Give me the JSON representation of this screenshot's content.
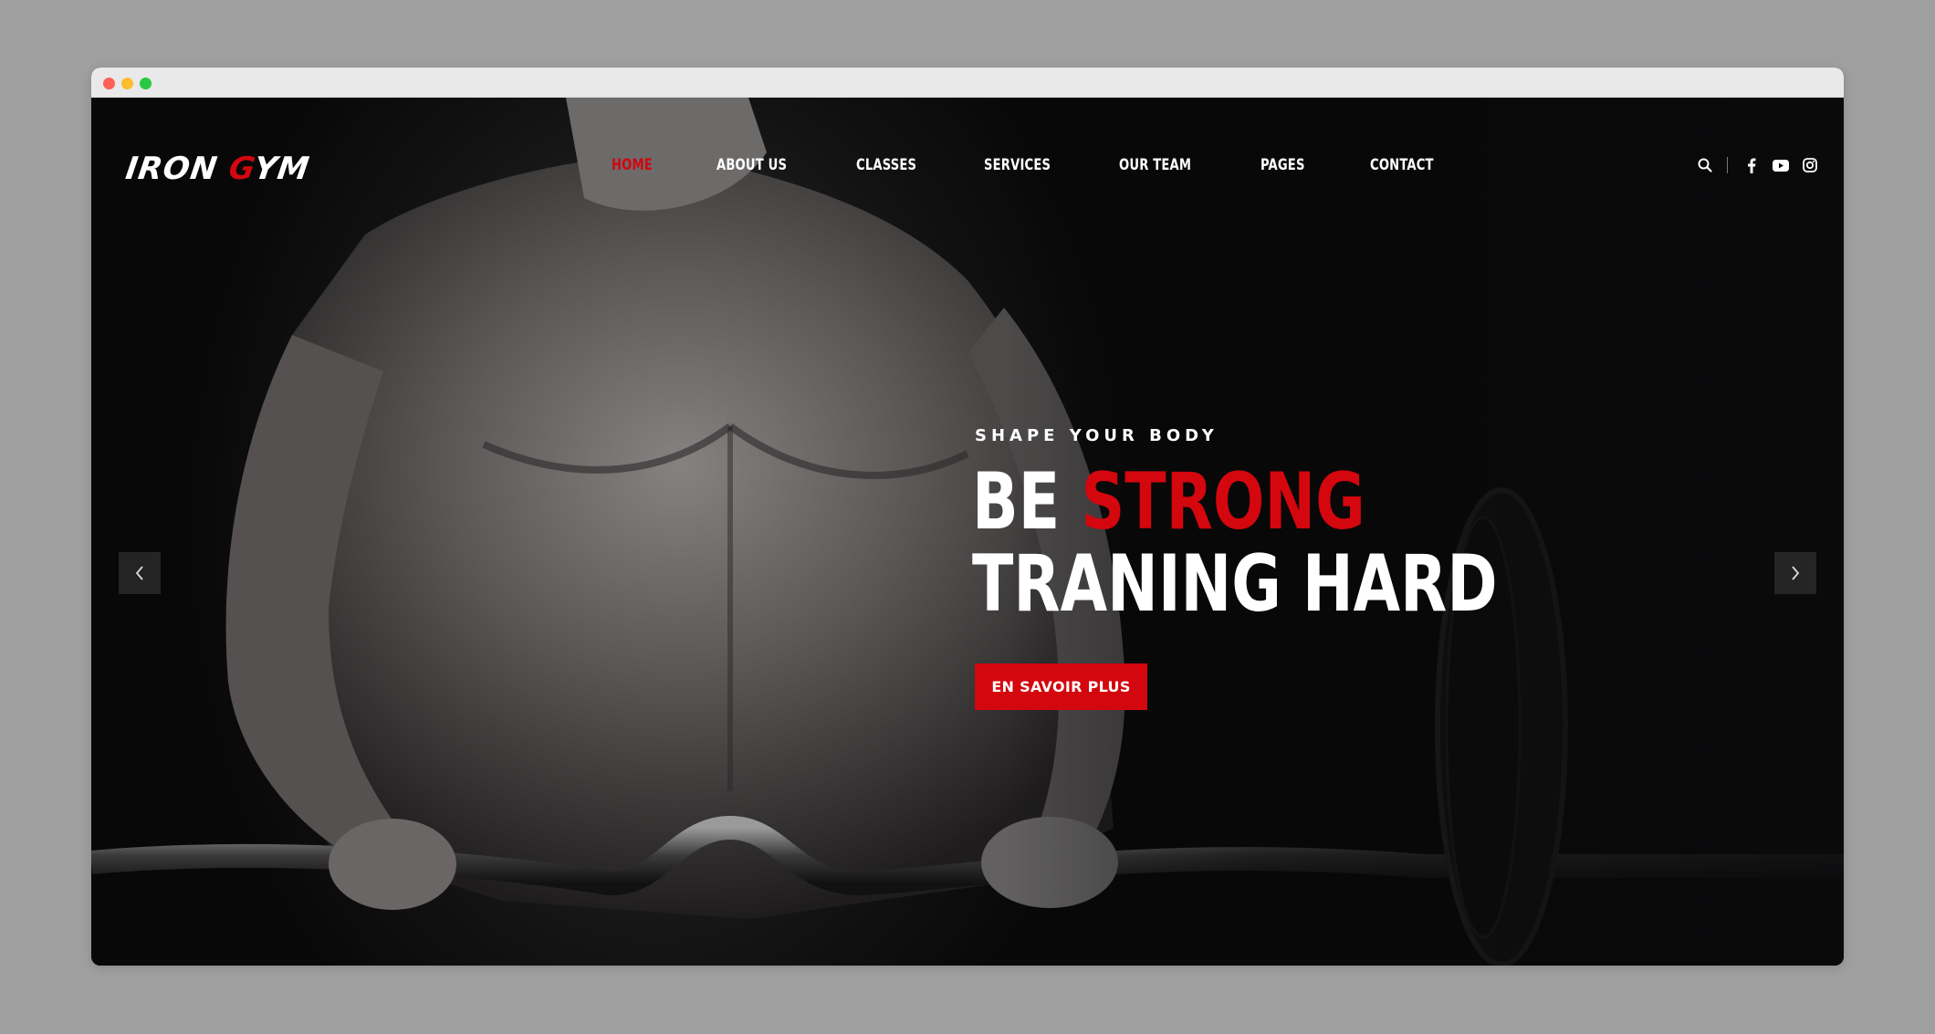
{
  "window": {
    "controls": [
      "close",
      "minimize",
      "zoom"
    ]
  },
  "brand": {
    "logo_text_1": "IRON ",
    "logo_text_bolt": "G",
    "logo_text_2": "YM",
    "accent_color": "#d4060e"
  },
  "nav": {
    "items": [
      {
        "label": "HOME",
        "active": true
      },
      {
        "label": "ABOUT US",
        "active": false
      },
      {
        "label": "CLASSES",
        "active": false
      },
      {
        "label": "SERVICES",
        "active": false
      },
      {
        "label": "OUR TEAM",
        "active": false
      },
      {
        "label": "PAGES",
        "active": false
      },
      {
        "label": "CONTACT",
        "active": false
      }
    ],
    "right_icons": [
      "search-icon",
      "facebook-icon",
      "youtube-icon",
      "instagram-icon"
    ]
  },
  "hero": {
    "subtitle": "SHAPE YOUR BODY",
    "headline_line1_a": "BE ",
    "headline_line1_b": "STRONG",
    "headline_line2": "TRANING HARD",
    "cta_label": "EN SAVOIR PLUS",
    "prev_icon": "chevron-left-icon",
    "next_icon": "chevron-right-icon"
  }
}
